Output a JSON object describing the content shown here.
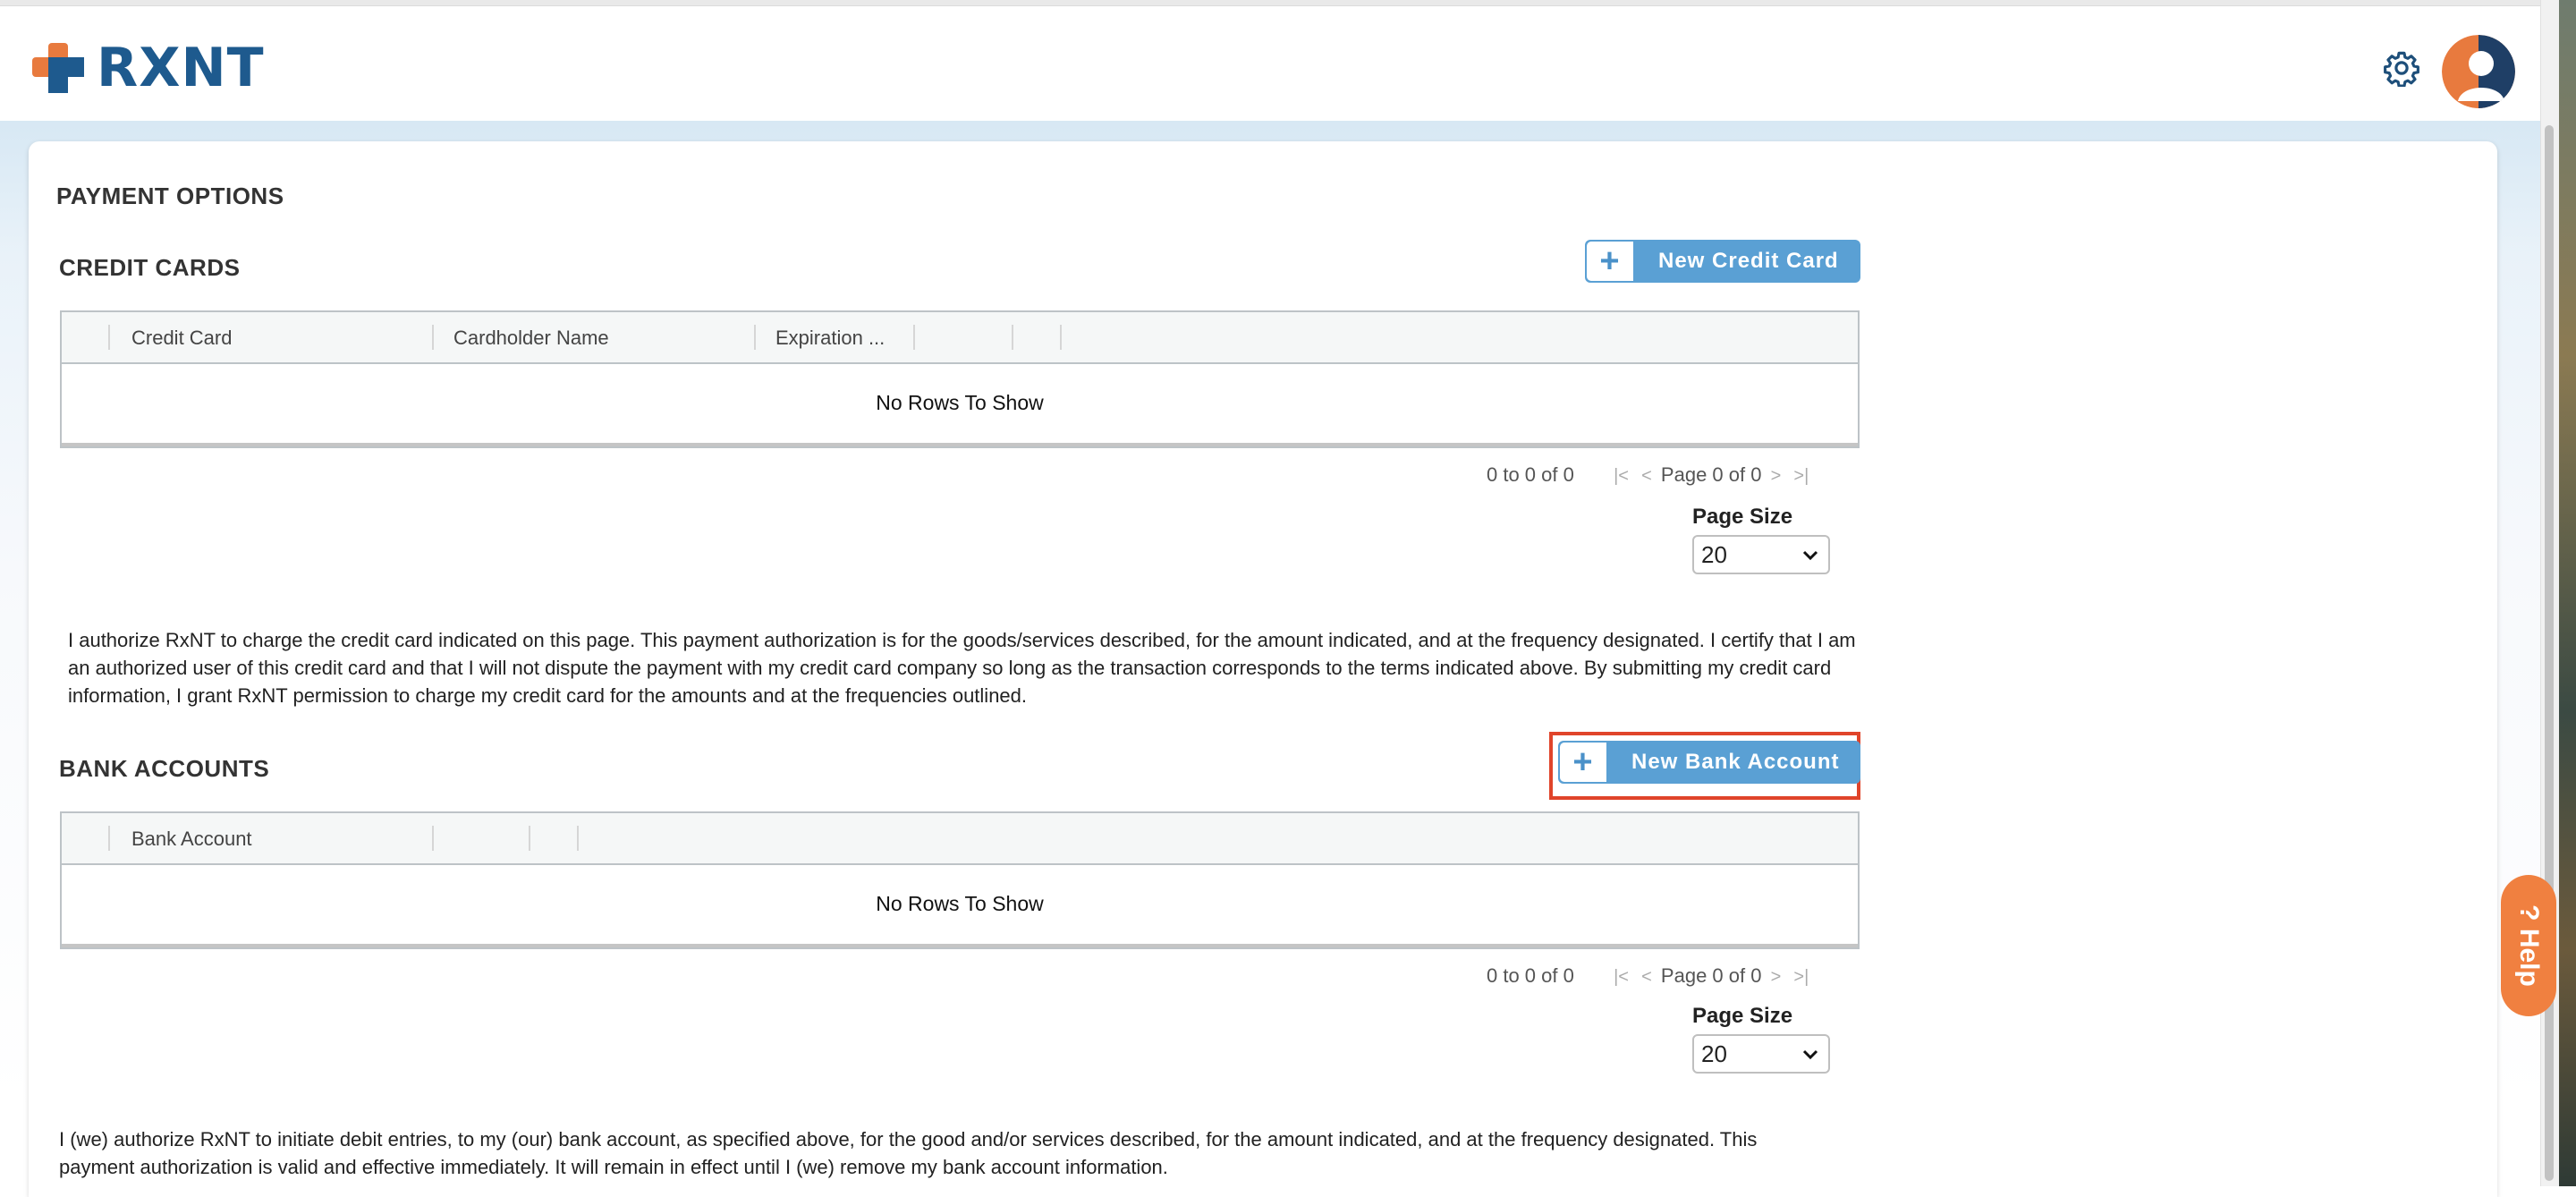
{
  "header": {
    "logo_text": "RXNT",
    "brand_colors": {
      "navy": "#1e5a8e",
      "orange": "#e87a3e"
    },
    "icons": [
      "gear-icon",
      "user-avatar-icon"
    ]
  },
  "page": {
    "title": "PAYMENT OPTIONS"
  },
  "credit_cards": {
    "section_title": "CREDIT CARDS",
    "new_button_icon": "plus-icon",
    "new_button_label": "New Credit Card",
    "columns": [
      "Credit Card",
      "Cardholder Name",
      "Expiration ..."
    ],
    "empty_text": "No Rows To Show",
    "pager": {
      "summary": "0 to 0 of 0",
      "page_text": "Page 0 of 0"
    },
    "page_size_label": "Page Size",
    "page_size_value": "20",
    "authorization_text": "I authorize RxNT to charge the credit card indicated on this page. This payment authorization is for the goods/services described, for the amount indicated, and at the frequency designated. I certify that I am an authorized user of this credit card and that I will not dispute the payment with my credit card company so long as the transaction corresponds to the terms indicated above. By submitting my credit card information, I grant RxNT permission to charge my credit card for the amounts and at the frequencies outlined."
  },
  "bank_accounts": {
    "section_title": "BANK ACCOUNTS",
    "new_button_icon": "plus-icon",
    "new_button_label": "New Bank Account",
    "columns": [
      "Bank Account"
    ],
    "empty_text": "No Rows To Show",
    "pager": {
      "summary": "0 to 0 of 0",
      "page_text": "Page 0 of 0"
    },
    "page_size_label": "Page Size",
    "page_size_value": "20",
    "authorization_text": "I (we) authorize RxNT to initiate debit entries, to my (our) bank account, as specified above, for the good and/or services described, for the amount indicated, and at the frequency designated. This payment authorization is valid and effective immediately. It will remain in effect until I (we) remove my bank account information."
  },
  "help_tab": {
    "label": "? Help",
    "color": "#f08040"
  },
  "colors": {
    "button": "#5aa0d4",
    "highlight": "#e0442a"
  }
}
